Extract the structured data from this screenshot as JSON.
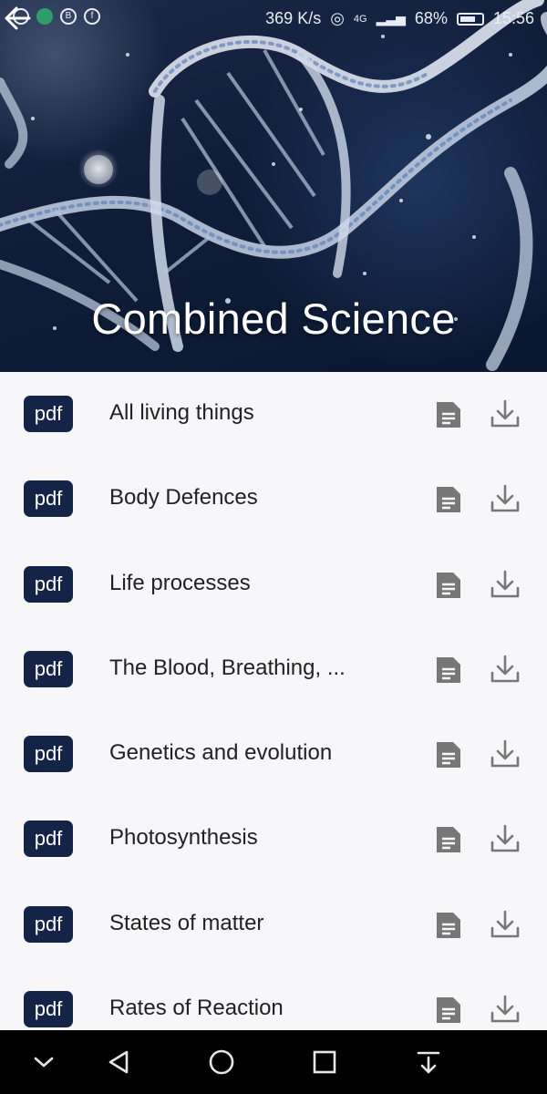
{
  "status_bar": {
    "network_speed": "369 K/s",
    "network_type": "4G",
    "battery": "68%",
    "time": "15:56",
    "left_icons": [
      "instagram-icon",
      "android-icon",
      "b-icon",
      "facebook-icon"
    ]
  },
  "header": {
    "title": "Combined Science",
    "back_icon": "arrow-left-icon"
  },
  "list": {
    "badge_label": "pdf",
    "items": [
      {
        "title": "All living things"
      },
      {
        "title": "Body Defences"
      },
      {
        "title": "Life processes"
      },
      {
        "title": "The Blood, Breathing, ..."
      },
      {
        "title": "Genetics and evolution"
      },
      {
        "title": "Photosynthesis"
      },
      {
        "title": "States of matter"
      },
      {
        "title": "Rates of Reaction"
      }
    ]
  },
  "nav_bar": {
    "buttons": [
      "chevron-down-icon",
      "back-triangle-icon",
      "home-circle-icon",
      "recents-square-icon",
      "notification-pull-icon"
    ]
  },
  "colors": {
    "badge": "#142447",
    "icon_gray": "#777777",
    "list_bg": "#f7f7f9"
  }
}
